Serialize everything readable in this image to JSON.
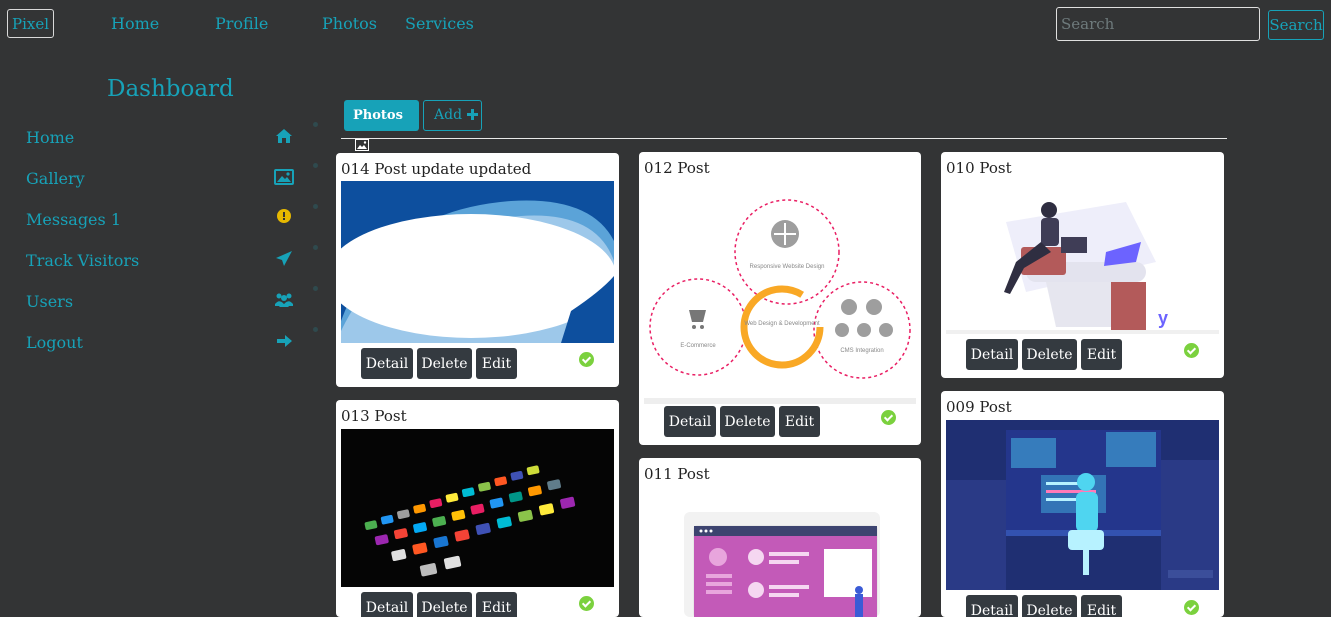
{
  "nav": {
    "brand": "Pixel",
    "links": [
      "Home",
      "Profile",
      "Photos",
      "Services"
    ],
    "search_placeholder": "Search",
    "search_button": "Search"
  },
  "sidebar": {
    "title": "Dashboard",
    "items": [
      {
        "label": "Home",
        "icon": "home-icon"
      },
      {
        "label": "Gallery",
        "icon": "image-icon"
      },
      {
        "label": "Messages 1",
        "icon": "exclamation-circle-icon"
      },
      {
        "label": "Track Visitors",
        "icon": "paper-plane-icon"
      },
      {
        "label": "Users",
        "icon": "users-icon"
      },
      {
        "label": "Logout",
        "icon": "arrow-right-icon"
      }
    ]
  },
  "tabs": {
    "photos": "Photos",
    "add": "Add"
  },
  "posts": [
    {
      "title": "014 Post update updated",
      "image": "blue-wave-abstract"
    },
    {
      "title": "013 Post",
      "image": "smartphone-apps-dark"
    },
    {
      "title": "012 Post",
      "image": "web-design-diagram"
    },
    {
      "title": "011 Post",
      "image": "profile-ui-illustration"
    },
    {
      "title": "010 Post",
      "image": "man-at-desk-illustration"
    },
    {
      "title": "009 Post",
      "image": "developer-screens-illustration"
    }
  ],
  "card_buttons": {
    "detail": "Detail",
    "delete": "Delete",
    "edit": "Edit"
  },
  "diagram_text": {
    "top": "Responsive Website Design",
    "left": "E-Commerce",
    "center": "Web Design & Development",
    "right": "CMS Integration"
  },
  "colors": {
    "accent": "#17a2b8",
    "background": "#333435",
    "button": "#343a40",
    "status": "#7bd13e"
  }
}
